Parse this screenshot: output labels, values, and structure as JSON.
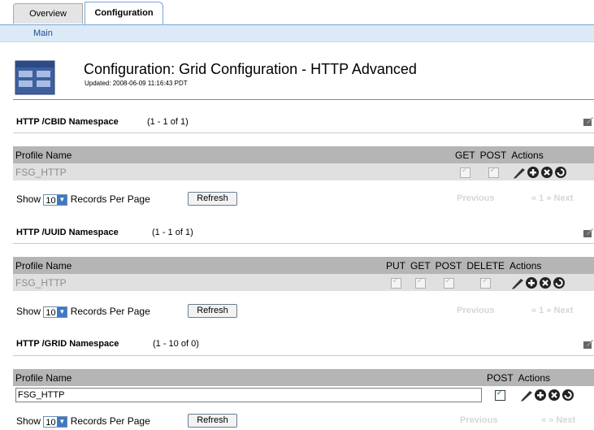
{
  "tabs": [
    {
      "label": "Overview"
    },
    {
      "label": "Configuration"
    }
  ],
  "subnav": {
    "item": "Main"
  },
  "header": {
    "title": "Configuration: Grid Configuration - HTTP Advanced",
    "updated": "Updated: 2008-06-09 11:16:43 PDT"
  },
  "sections": [
    {
      "title": "HTTP /CBID Namespace",
      "count": "(1 - 1 of 1)",
      "columns": [
        "Profile Name",
        "GET",
        "POST",
        "Actions"
      ],
      "rows": [
        {
          "name": "FSG_HTTP",
          "checks": [
            true,
            true
          ]
        }
      ]
    },
    {
      "title": "HTTP /UUID Namespace",
      "count": "(1 - 1 of 1)",
      "columns": [
        "Profile Name",
        "PUT",
        "GET",
        "POST",
        "DELETE",
        "Actions"
      ],
      "rows": [
        {
          "name": "FSG_HTTP",
          "checks": [
            true,
            true,
            true,
            true
          ]
        }
      ]
    },
    {
      "title": "HTTP /GRID Namespace",
      "count": "(1 - 10 of 0)",
      "columns": [
        "Profile Name",
        "POST",
        "Actions"
      ],
      "rows": [
        {
          "name": "FSG_HTTP",
          "checks": [
            true
          ]
        }
      ]
    }
  ],
  "pagination": {
    "show": "Show",
    "per_page_value": "10",
    "records_per_page": "Records Per Page",
    "refresh": "Refresh",
    "previous": "Previous",
    "page_a": "« 1 » Next",
    "page_b": "« » Next"
  },
  "icons": [
    "grid-config-icon",
    "edit-icon",
    "pencil-icon",
    "plus-icon",
    "delete-icon",
    "reset-icon"
  ]
}
